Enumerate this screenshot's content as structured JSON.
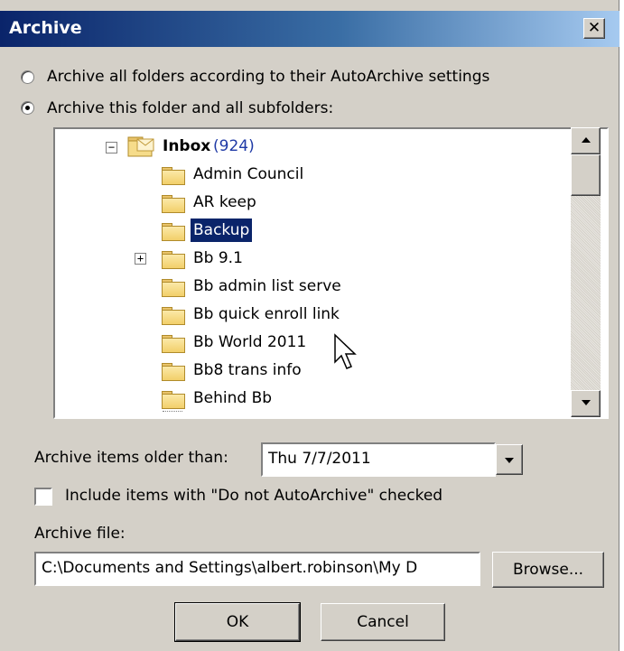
{
  "dialog": {
    "title": "Archive",
    "close_glyph": "✕",
    "option_all_label": "Archive all folders according to their AutoArchive settings",
    "option_folder_label": "Archive this folder and all subfolders:",
    "selected_option": "folder"
  },
  "tree": {
    "root": {
      "name": "Inbox",
      "count": "(924)",
      "expander": "−"
    },
    "items": [
      {
        "label": "Admin Council"
      },
      {
        "label": "AR keep"
      },
      {
        "label": "Backup",
        "selected": true
      },
      {
        "label": "Bb 9.1",
        "expander": "+"
      },
      {
        "label": "Bb admin list serve"
      },
      {
        "label": "Bb quick enroll link"
      },
      {
        "label": "Bb World 2011"
      },
      {
        "label": "Bb8 trans info"
      },
      {
        "label": "Behind Bb"
      }
    ]
  },
  "archive_older": {
    "label": "Archive items older than:",
    "value": "Thu 7/7/2011"
  },
  "include_checkbox": {
    "label": "Include items with \"Do not AutoArchive\" checked",
    "checked": false
  },
  "archive_file": {
    "label": "Archive file:",
    "value": "C:\\Documents and Settings\\albert.robinson\\My D",
    "browse_label": "Browse..."
  },
  "buttons": {
    "ok_label": "OK",
    "cancel_label": "Cancel"
  },
  "colors": {
    "selection": "#0a246a",
    "dialog_bg": "#d4d0c8",
    "count_color": "#1f3aa6"
  }
}
